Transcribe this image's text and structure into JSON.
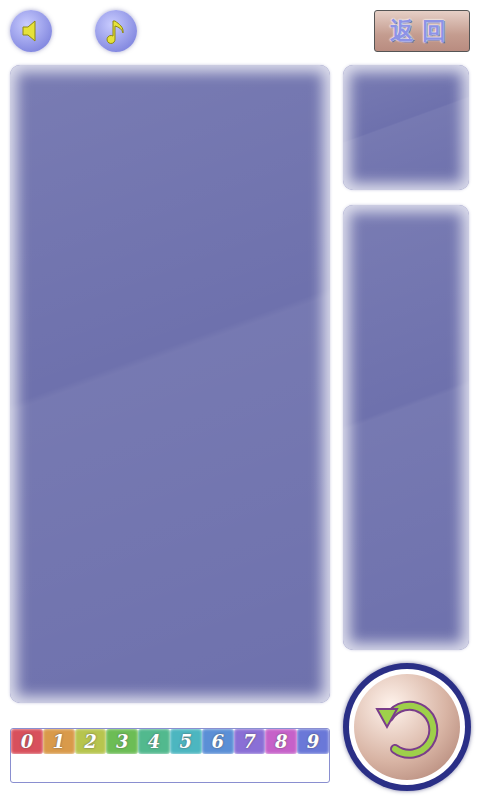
{
  "header": {
    "back_button": "返回"
  },
  "digits": [
    {
      "label": "0",
      "color": "#d8505c"
    },
    {
      "label": "1",
      "color": "#d99a4a"
    },
    {
      "label": "2",
      "color": "#b7c54e"
    },
    {
      "label": "3",
      "color": "#6cbd55"
    },
    {
      "label": "4",
      "color": "#52b98e"
    },
    {
      "label": "5",
      "color": "#4cb6c0"
    },
    {
      "label": "6",
      "color": "#5b8fd6"
    },
    {
      "label": "7",
      "color": "#8a6fd6"
    },
    {
      "label": "8",
      "color": "#c661c9"
    },
    {
      "label": "9",
      "color": "#6a78d8"
    }
  ]
}
